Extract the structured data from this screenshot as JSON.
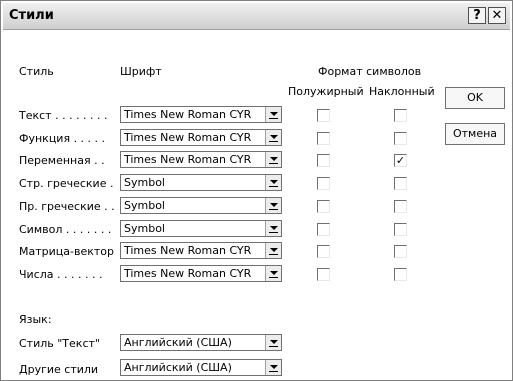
{
  "window": {
    "title": "Стили",
    "help_button": "?",
    "close_button": "✕"
  },
  "headers": {
    "style": "Стиль",
    "font": "Шрифт",
    "format": "Формат символов",
    "bold": "Полужирный",
    "italic": "Наклонный"
  },
  "rows": [
    {
      "label": "Текст . . . . . . . .",
      "font": "Times New Roman CYR",
      "bold": false,
      "italic": false
    },
    {
      "label": "Функция . . . . .",
      "font": "Times New Roman CYR",
      "bold": false,
      "italic": false
    },
    {
      "label": "Переменная . .",
      "font": "Times New Roman CYR",
      "bold": false,
      "italic": true
    },
    {
      "label": "Стр. греческие .",
      "font": "Symbol",
      "bold": false,
      "italic": false
    },
    {
      "label": "Пр. греческие . .",
      "font": "Symbol",
      "bold": false,
      "italic": false
    },
    {
      "label": "Символ . . . . . . .",
      "font": "Symbol",
      "bold": false,
      "italic": false
    },
    {
      "label": "Матрица-вектор",
      "font": "Times New Roman CYR",
      "bold": false,
      "italic": false
    },
    {
      "label": "Числа . . . . . . .",
      "font": "Times New Roman CYR",
      "bold": false,
      "italic": false
    }
  ],
  "language": {
    "header": "Язык:",
    "text_style_label": "Стиль \"Текст\"",
    "text_style_value": "Английский (США)",
    "other_styles_label": "Другие стили",
    "other_styles_value": "Английский (США)"
  },
  "buttons": {
    "ok": "OK",
    "cancel": "Отмена"
  },
  "colors": {
    "titlebar_top": "#f0f0f0",
    "titlebar_bottom": "#cfcfcf",
    "background": "#ffffff"
  }
}
